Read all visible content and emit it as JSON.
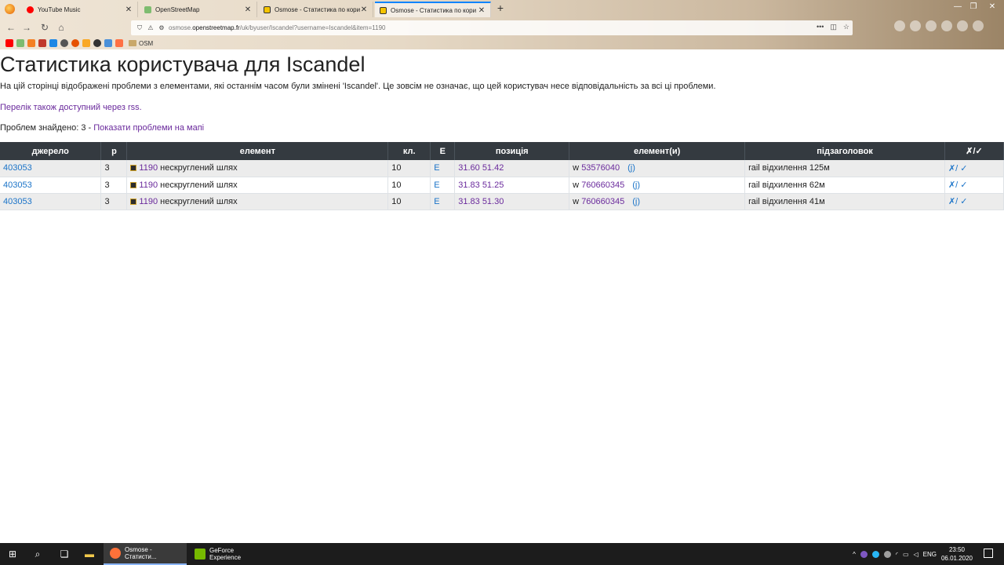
{
  "browser": {
    "tabs": [
      {
        "title": "YouTube Music",
        "favicon_color": "#ff0000"
      },
      {
        "title": "OpenStreetMap",
        "favicon_color": "#7ebc6f"
      },
      {
        "title": "Osmose - Статистика по кори",
        "favicon_color": "#f5c400"
      },
      {
        "title": "Osmose - Статистика по кори",
        "favicon_color": "#f5c400"
      }
    ],
    "url": {
      "prefix": "osmose.",
      "domain": "openstreetmap.fr",
      "path": "/uk/byuser/Iscandel?username=Iscandel&item=1190"
    },
    "bookmark_folder": "OSM"
  },
  "page": {
    "title": "Статистика користувача для Iscandel",
    "description": "На цій сторінці відображені проблеми з елементами, які останнім часом були змінені 'Iscandel'. Це зовсім не означає, що цей користувач несе відповідальність за всі ці проблеми.",
    "rss_link": "Перелік також доступний через rss.",
    "found_label": "Проблем знайдено: 3 -",
    "show_map_link": "Показати проблеми на мапі"
  },
  "table": {
    "headers": [
      "джерело",
      "р",
      "елемент",
      "кл.",
      "E",
      "позиція",
      "елемент(и)",
      "підзаголовок",
      "✗/✓"
    ],
    "rows": [
      {
        "source": "403053",
        "level": "3",
        "item": "1190",
        "item_text": "нескруглений шлях",
        "class": "10",
        "e": "E",
        "position": "31.60 51.42",
        "elem_type": "w",
        "elem_id": "53576040",
        "josm": "(j)",
        "subtitle": "rail відхилення 125м",
        "fix": "✗/ ✓"
      },
      {
        "source": "403053",
        "level": "3",
        "item": "1190",
        "item_text": "нескруглений шлях",
        "class": "10",
        "e": "E",
        "position": "31.83 51.25",
        "elem_type": "w",
        "elem_id": "760660345",
        "josm": "(j)",
        "subtitle": "rail відхилення 62м",
        "fix": "✗/ ✓"
      },
      {
        "source": "403053",
        "level": "3",
        "item": "1190",
        "item_text": "нескруглений шлях",
        "class": "10",
        "e": "E",
        "position": "31.83 51.30",
        "elem_type": "w",
        "elem_id": "760660345",
        "josm": "(j)",
        "subtitle": "rail відхилення 41м",
        "fix": "✗/ ✓"
      }
    ]
  },
  "taskbar": {
    "apps": [
      {
        "label": "Osmose - Статисти...",
        "icon_color": "#ff7139"
      },
      {
        "label": "GeForce Experience",
        "icon_color": "#76b900"
      }
    ],
    "language": "ENG",
    "time": "23:50",
    "date": "06.01.2020"
  }
}
